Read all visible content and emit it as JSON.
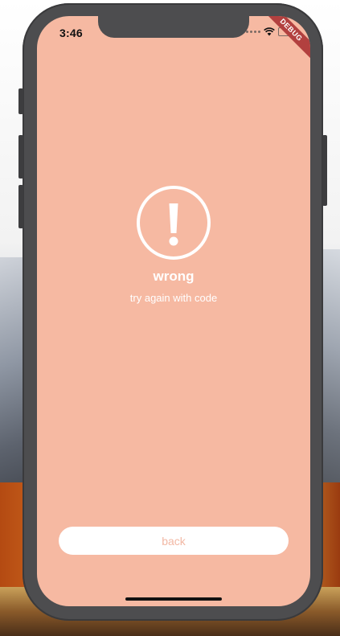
{
  "status_bar": {
    "time": "3:46",
    "icons": [
      "signal-dots-icon",
      "wifi-icon",
      "battery-icon"
    ]
  },
  "debug_banner": {
    "label": "DEBUG",
    "color": "#b2403f"
  },
  "error": {
    "icon": "exclamation-circle-icon",
    "title": "wrong",
    "subtitle": "try again with code"
  },
  "actions": {
    "back_label": "back"
  },
  "colors": {
    "screen_background": "#f6b9a2",
    "text": "#ffffff",
    "button_background": "#ffffff",
    "button_text": "#f2b8a4"
  }
}
